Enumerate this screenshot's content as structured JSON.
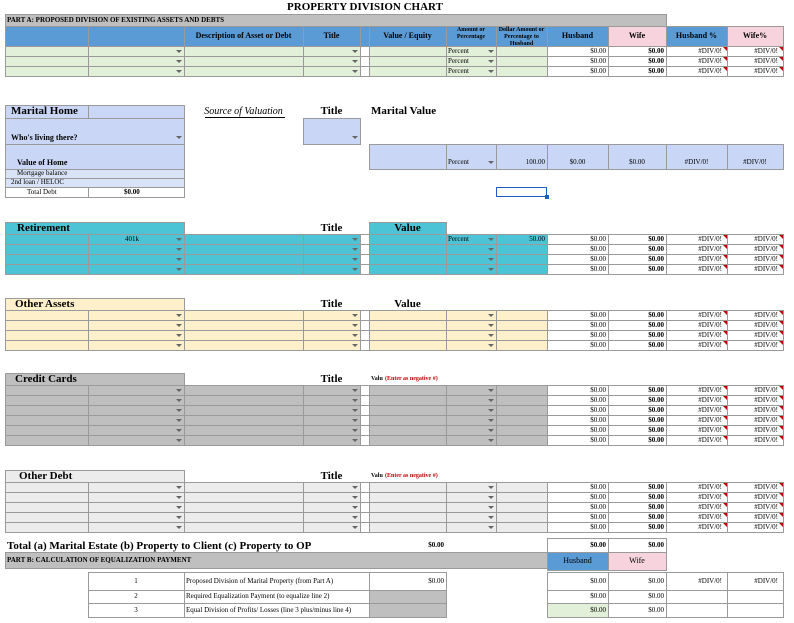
{
  "title": "PROPERTY DIVISION CHART",
  "partA": {
    "label": "PART A:  PROPOSED DIVISION OF EXISTING ASSETS AND DEBTS",
    "headers": {
      "description": "Description of Asset or Debt",
      "title": "Title",
      "value_equity": "Value / Equity",
      "amount_or_percentage": "Amount or Percentage",
      "dollar_amount": "Dollar Amount or Percentage to Husband",
      "husband": "Husband",
      "wife": "Wife",
      "husband_pct": "Husband %",
      "wife_pct": "Wife%"
    },
    "rows": [
      {
        "type": "Percent",
        "husband": "$0.00",
        "wife": "$0.00",
        "husband_pct": "#DIV/0!",
        "wife_pct": "#DIV/0!"
      },
      {
        "type": "Percent",
        "husband": "$0.00",
        "wife": "$0.00",
        "husband_pct": "#DIV/0!",
        "wife_pct": "#DIV/0!"
      },
      {
        "type": "Percent",
        "husband": "$0.00",
        "wife": "$0.00",
        "husband_pct": "#DIV/0!",
        "wife_pct": "#DIV/0!"
      }
    ]
  },
  "marital_home": {
    "label": "Marital Home",
    "source_label": "Source of Valuation",
    "title_label": "Title",
    "value_label": "Marital Value",
    "living_label": "Who's living there?",
    "value_of_home_label": "Value of Home",
    "percent": "Percent",
    "amount": "100.00",
    "value": "$0.00",
    "husband": "$0.00",
    "wife": "$0.00",
    "husband_pct": "#DIV/0!",
    "wife_pct": "#DIV/0!",
    "mortgage_label": "Mortgage balance",
    "loan_label": "2nd loan / HELOC",
    "total_debt_label": "Total Debt",
    "total_debt_value": "$0.00"
  },
  "retirement": {
    "label": "Retirement",
    "title_label": "Title",
    "value_label": "Value",
    "rows": [
      {
        "desc": "401k",
        "type": "Percent",
        "amount": "50.00",
        "husband": "$0.00",
        "wife": "$0.00",
        "husband_pct": "#DIV/0!",
        "wife_pct": "#DIV/0!"
      },
      {
        "desc": "",
        "type": "",
        "amount": "",
        "husband": "$0.00",
        "wife": "$0.00",
        "husband_pct": "#DIV/0!",
        "wife_pct": "#DIV/0!"
      },
      {
        "desc": "",
        "type": "",
        "amount": "",
        "husband": "$0.00",
        "wife": "$0.00",
        "husband_pct": "#DIV/0!",
        "wife_pct": "#DIV/0!"
      },
      {
        "desc": "",
        "type": "",
        "amount": "",
        "husband": "$0.00",
        "wife": "$0.00",
        "husband_pct": "#DIV/0!",
        "wife_pct": "#DIV/0!"
      }
    ]
  },
  "other_assets": {
    "label": "Other Assets",
    "title_label": "Title",
    "value_label": "Value",
    "rows": [
      {
        "husband": "$0.00",
        "wife": "$0.00",
        "husband_pct": "#DIV/0!",
        "wife_pct": "#DIV/0!"
      },
      {
        "husband": "$0.00",
        "wife": "$0.00",
        "husband_pct": "#DIV/0!",
        "wife_pct": "#DIV/0!"
      },
      {
        "husband": "$0.00",
        "wife": "$0.00",
        "husband_pct": "#DIV/0!",
        "wife_pct": "#DIV/0!"
      },
      {
        "husband": "$0.00",
        "wife": "$0.00",
        "husband_pct": "#DIV/0!",
        "wife_pct": "#DIV/0!"
      }
    ]
  },
  "credit_cards": {
    "label": "Credit Cards",
    "title_label": "Title",
    "value_label": "Value",
    "value_note": "(Enter as negative #)",
    "rows": [
      {
        "husband": "$0.00",
        "wife": "$0.00",
        "husband_pct": "#DIV/0!",
        "wife_pct": "#DIV/0!"
      },
      {
        "husband": "$0.00",
        "wife": "$0.00",
        "husband_pct": "#DIV/0!",
        "wife_pct": "#DIV/0!"
      },
      {
        "husband": "$0.00",
        "wife": "$0.00",
        "husband_pct": "#DIV/0!",
        "wife_pct": "#DIV/0!"
      },
      {
        "husband": "$0.00",
        "wife": "$0.00",
        "husband_pct": "#DIV/0!",
        "wife_pct": "#DIV/0!"
      },
      {
        "husband": "$0.00",
        "wife": "$0.00",
        "husband_pct": "#DIV/0!",
        "wife_pct": "#DIV/0!"
      },
      {
        "husband": "$0.00",
        "wife": "$0.00",
        "husband_pct": "#DIV/0!",
        "wife_pct": "#DIV/0!"
      }
    ]
  },
  "other_debt": {
    "label": "Other Debt",
    "title_label": "Title",
    "value_label": "Value",
    "value_note": "(Enter as negative #)",
    "rows": [
      {
        "husband": "$0.00",
        "wife": "$0.00",
        "husband_pct": "#DIV/0!",
        "wife_pct": "#DIV/0!"
      },
      {
        "husband": "$0.00",
        "wife": "$0.00",
        "husband_pct": "#DIV/0!",
        "wife_pct": "#DIV/0!"
      },
      {
        "husband": "$0.00",
        "wife": "$0.00",
        "husband_pct": "#DIV/0!",
        "wife_pct": "#DIV/0!"
      },
      {
        "husband": "$0.00",
        "wife": "$0.00",
        "husband_pct": "#DIV/0!",
        "wife_pct": "#DIV/0!"
      },
      {
        "husband": "$0.00",
        "wife": "$0.00",
        "husband_pct": "#DIV/0!",
        "wife_pct": "#DIV/0!"
      }
    ]
  },
  "totals": {
    "label": "Total (a) Marital Estate (b) Property to Client (c) Property to OP",
    "estate": "$0.00",
    "husband": "$0.00",
    "wife": "$0.00"
  },
  "partB": {
    "label": "PART B:  CALCULATION OF EQUALIZATION PAYMENT",
    "husband": "Husband",
    "wife": "Wife",
    "rows": [
      {
        "num": "1",
        "desc": "Proposed Division of Marital Property (from Part A)",
        "value": "$0.00",
        "husband": "$0.00",
        "wife": "$0.00",
        "husband_pct": "#DIV/0!",
        "wife_pct": "#DIV/0!"
      },
      {
        "num": "2",
        "desc": "Required Equalization Payment (to equalize line 2)",
        "value": "",
        "husband": "$0.00",
        "wife": "$0.00",
        "husband_pct": "",
        "wife_pct": ""
      },
      {
        "num": "3",
        "desc": "Equal Division of Profits/ Losses (line 3 plus/minus line 4)",
        "value": "",
        "husband": "$0.00",
        "wife": "$0.00",
        "husband_pct": "",
        "wife_pct": ""
      }
    ]
  }
}
